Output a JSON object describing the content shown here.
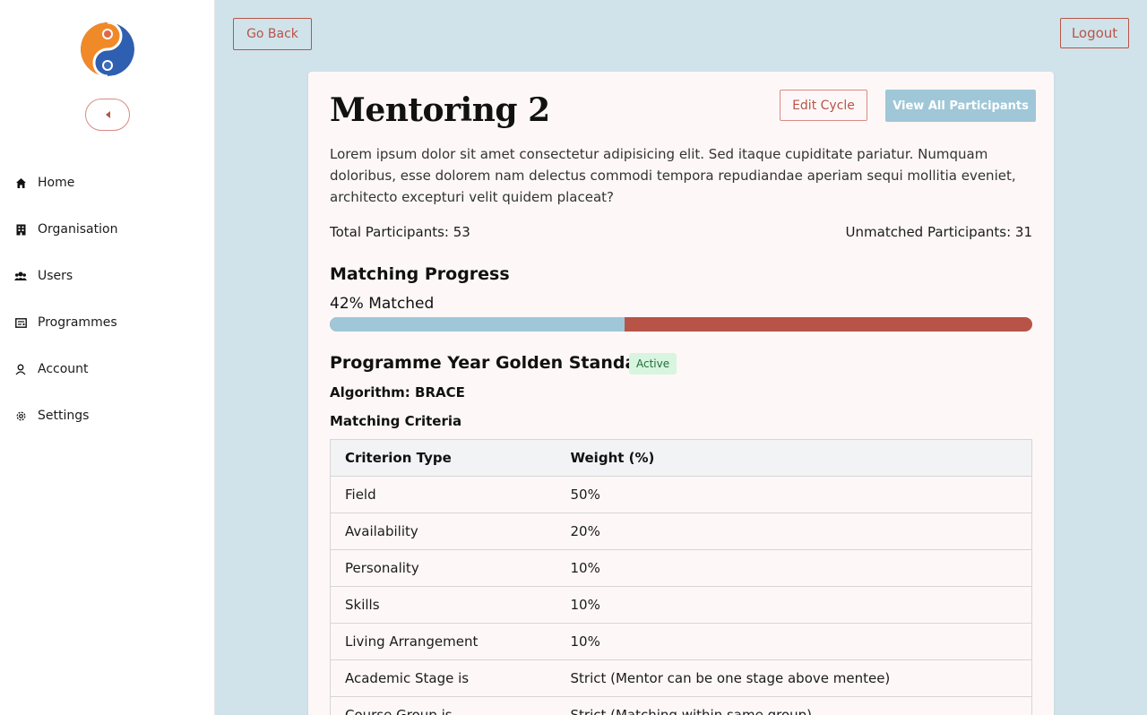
{
  "sidebar": {
    "items": [
      {
        "label": "Home",
        "icon": "home-icon"
      },
      {
        "label": "Organisation",
        "icon": "building-icon"
      },
      {
        "label": "Users",
        "icon": "users-icon"
      },
      {
        "label": "Programmes",
        "icon": "programmes-icon"
      },
      {
        "label": "Account",
        "icon": "user-icon"
      },
      {
        "label": "Settings",
        "icon": "gear-icon"
      }
    ]
  },
  "header": {
    "go_back": "Go Back",
    "logout": "Logout"
  },
  "cycle": {
    "title": "Mentoring 2",
    "edit_label": "Edit Cycle",
    "view_all_label": "View All Participants",
    "description": "Lorem ipsum dolor sit amet consectetur adipisicing elit. Sed itaque cupiditate pariatur. Numquam doloribus, esse dolorem nam delectus commodi tempora repudiandae aperiam sequi mollitia eveniet, architecto excepturi velit quidem placeat?",
    "total_participants": "Total Participants: 53",
    "unmatched_participants": "Unmatched Participants: 31",
    "matching_heading": "Matching Progress",
    "matched_label": "42% Matched",
    "matched_fraction": 0.42
  },
  "programme": {
    "name": "Programme Year Golden Standard",
    "status": "Active",
    "algorithm": "Algorithm: BRACE",
    "criteria_heading": "Matching Criteria",
    "columns": [
      "Criterion Type",
      "Weight (%)"
    ],
    "rows": [
      [
        "Field",
        "50%"
      ],
      [
        "Availability",
        "20%"
      ],
      [
        "Personality",
        "10%"
      ],
      [
        "Skills",
        "10%"
      ],
      [
        "Living Arrangement",
        "10%"
      ],
      [
        "Academic Stage is",
        "Strict (Mentor can be one stage above mentee)"
      ],
      [
        "Course Group is",
        "Strict (Matching within same group)"
      ]
    ]
  },
  "colors": {
    "accent": "#b85447",
    "progress_fill": "#9fc7d8",
    "background": "#d1e3ea",
    "badge_bg": "#d7f5df"
  }
}
